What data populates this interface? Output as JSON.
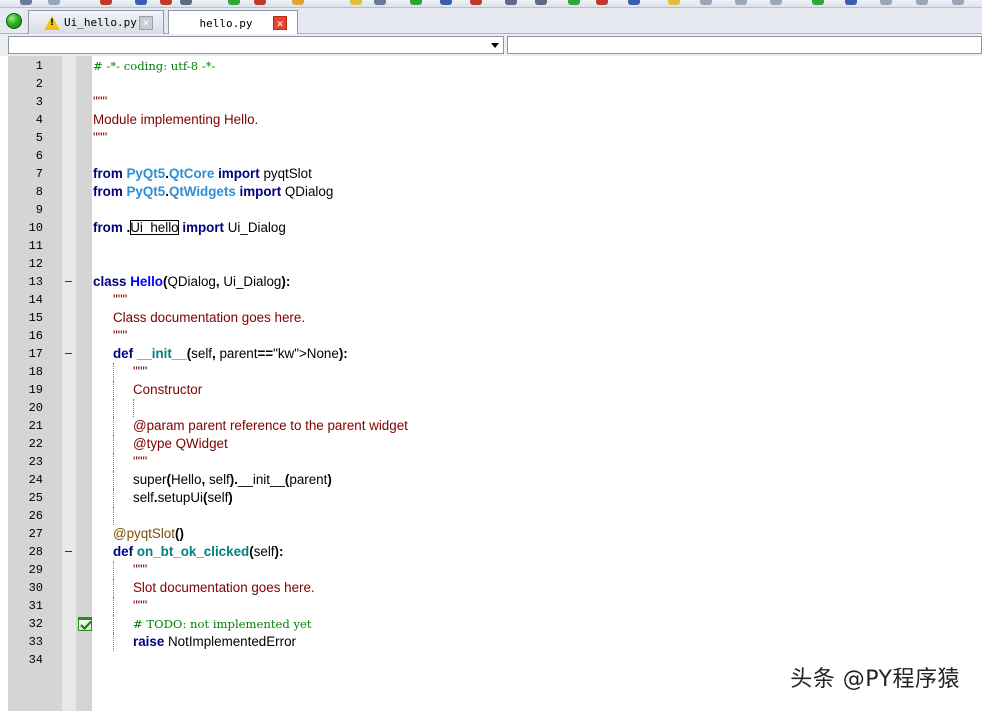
{
  "tabs": [
    {
      "label": "Ui_hello.py",
      "icon": "warning-icon",
      "active": false
    },
    {
      "label": "hello.py",
      "icon": "",
      "active": true
    }
  ],
  "close_glyph": "✕",
  "combo_left": "",
  "combo_right": "",
  "editor": {
    "lines": [
      {
        "num": "1",
        "code": "# -*- coding: utf-8 -*-"
      },
      {
        "num": "2",
        "code": ""
      },
      {
        "num": "3",
        "code": "\"\"\""
      },
      {
        "num": "4",
        "code": "Module implementing Hello."
      },
      {
        "num": "5",
        "code": "\"\"\""
      },
      {
        "num": "6",
        "code": ""
      },
      {
        "num": "7",
        "code": "from PyQt5.QtCore import pyqtSlot"
      },
      {
        "num": "8",
        "code": "from PyQt5.QtWidgets import QDialog"
      },
      {
        "num": "9",
        "code": ""
      },
      {
        "num": "10",
        "code": "from .Ui_hello import Ui_Dialog"
      },
      {
        "num": "11",
        "code": ""
      },
      {
        "num": "12",
        "code": ""
      },
      {
        "num": "13",
        "code": "class Hello(QDialog, Ui_Dialog):"
      },
      {
        "num": "14",
        "code": "    \"\"\""
      },
      {
        "num": "15",
        "code": "    Class documentation goes here."
      },
      {
        "num": "16",
        "code": "    \"\"\""
      },
      {
        "num": "17",
        "code": "    def __init__(self, parent=None):"
      },
      {
        "num": "18",
        "code": "        \"\"\""
      },
      {
        "num": "19",
        "code": "        Constructor"
      },
      {
        "num": "20",
        "code": ""
      },
      {
        "num": "21",
        "code": "        @param parent reference to the parent widget"
      },
      {
        "num": "22",
        "code": "        @type QWidget"
      },
      {
        "num": "23",
        "code": "        \"\"\""
      },
      {
        "num": "24",
        "code": "        super(Hello, self).__init__(parent)"
      },
      {
        "num": "25",
        "code": "        self.setupUi(self)"
      },
      {
        "num": "26",
        "code": ""
      },
      {
        "num": "27",
        "code": "    @pyqtSlot()"
      },
      {
        "num": "28",
        "code": "    def on_bt_ok_clicked(self):"
      },
      {
        "num": "29",
        "code": "        \"\"\""
      },
      {
        "num": "30",
        "code": "        Slot documentation goes here."
      },
      {
        "num": "31",
        "code": "        \"\"\""
      },
      {
        "num": "32",
        "code": "        # TODO: not implemented yet"
      },
      {
        "num": "33",
        "code": "        raise NotImplementedError"
      },
      {
        "num": "34",
        "code": ""
      }
    ]
  },
  "watermark": "头条 @PY程序猿"
}
